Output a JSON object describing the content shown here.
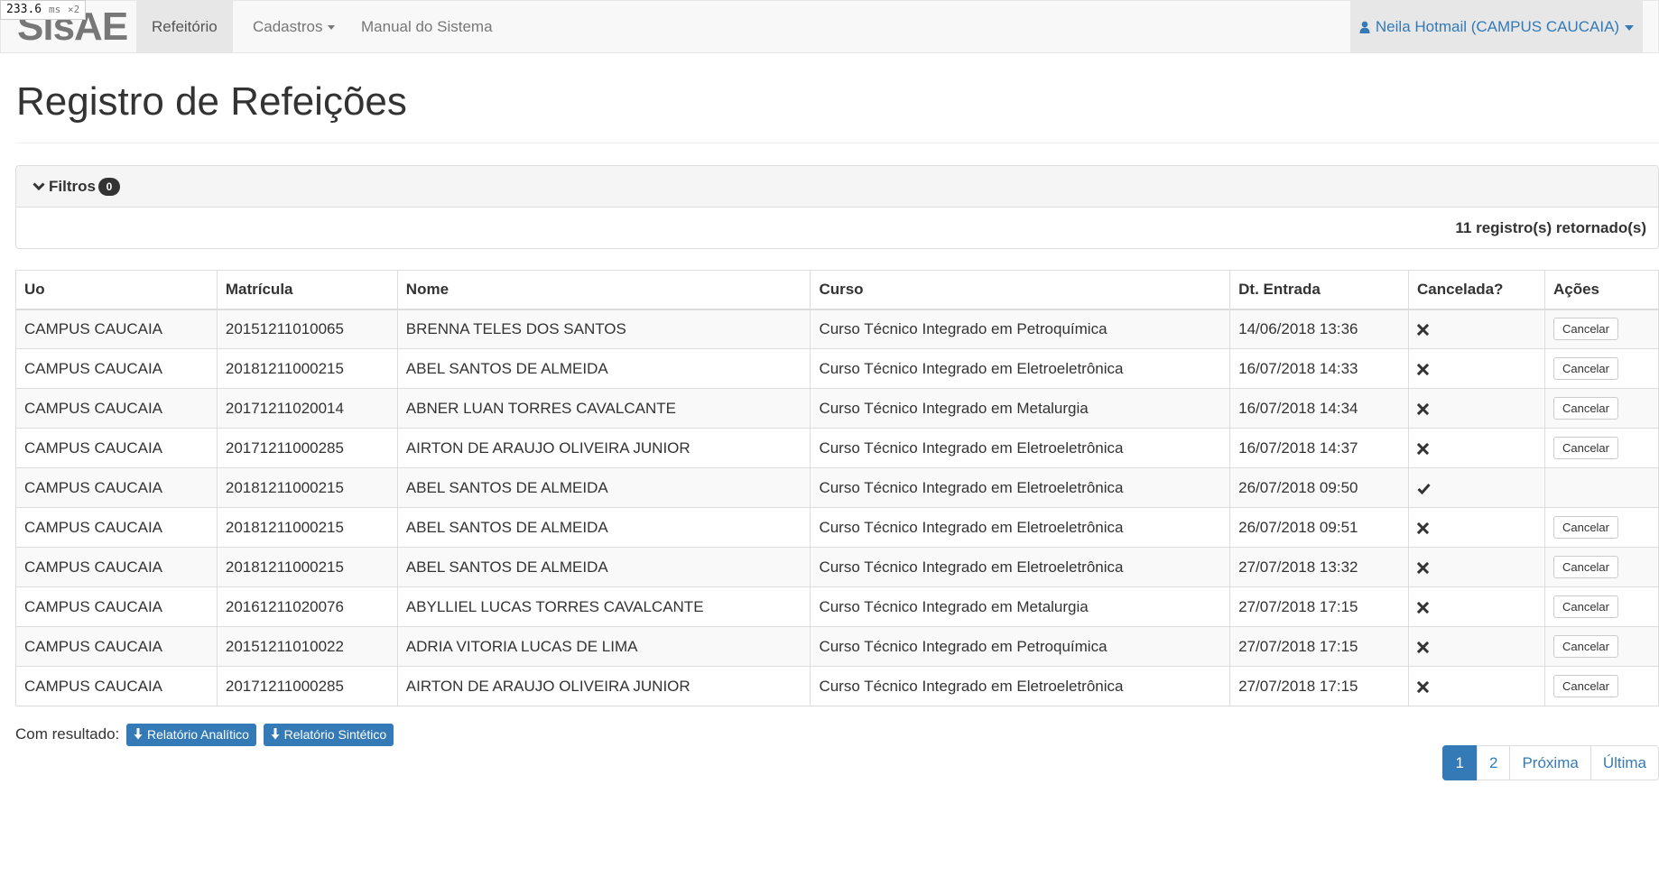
{
  "perf": {
    "value": "233.6",
    "unit": "ms",
    "multiplier": "×2"
  },
  "navbar": {
    "brand": "SisAE",
    "items": [
      {
        "label": "Refeitório"
      },
      {
        "label": "Cadastros"
      },
      {
        "label": "Manual do Sistema"
      }
    ],
    "user": "Neila Hotmail (CAMPUS CAUCAIA)"
  },
  "page": {
    "title": "Registro de Refeições"
  },
  "filters": {
    "label": "Filtros",
    "count": "0",
    "results_text": "11 registro(s) retornado(s)"
  },
  "table": {
    "headers": [
      "Uo",
      "Matrícula",
      "Nome",
      "Curso",
      "Dt. Entrada",
      "Cancelada?",
      "Ações"
    ],
    "action_label": "Cancelar",
    "rows": [
      {
        "uo": "CAMPUS CAUCAIA",
        "matricula": "20151211010065",
        "nome": "BRENNA TELES DOS SANTOS",
        "curso": "Curso Técnico Integrado em Petroquímica",
        "entrada": "14/06/2018 13:36",
        "cancelada": false
      },
      {
        "uo": "CAMPUS CAUCAIA",
        "matricula": "20181211000215",
        "nome": "ABEL SANTOS DE ALMEIDA",
        "curso": "Curso Técnico Integrado em Eletroeletrônica",
        "entrada": "16/07/2018 14:33",
        "cancelada": false
      },
      {
        "uo": "CAMPUS CAUCAIA",
        "matricula": "20171211020014",
        "nome": "ABNER LUAN TORRES CAVALCANTE",
        "curso": "Curso Técnico Integrado em Metalurgia",
        "entrada": "16/07/2018 14:34",
        "cancelada": false
      },
      {
        "uo": "CAMPUS CAUCAIA",
        "matricula": "20171211000285",
        "nome": "AIRTON DE ARAUJO OLIVEIRA JUNIOR",
        "curso": "Curso Técnico Integrado em Eletroeletrônica",
        "entrada": "16/07/2018 14:37",
        "cancelada": false
      },
      {
        "uo": "CAMPUS CAUCAIA",
        "matricula": "20181211000215",
        "nome": "ABEL SANTOS DE ALMEIDA",
        "curso": "Curso Técnico Integrado em Eletroeletrônica",
        "entrada": "26/07/2018 09:50",
        "cancelada": true
      },
      {
        "uo": "CAMPUS CAUCAIA",
        "matricula": "20181211000215",
        "nome": "ABEL SANTOS DE ALMEIDA",
        "curso": "Curso Técnico Integrado em Eletroeletrônica",
        "entrada": "26/07/2018 09:51",
        "cancelada": false
      },
      {
        "uo": "CAMPUS CAUCAIA",
        "matricula": "20181211000215",
        "nome": "ABEL SANTOS DE ALMEIDA",
        "curso": "Curso Técnico Integrado em Eletroeletrônica",
        "entrada": "27/07/2018 13:32",
        "cancelada": false
      },
      {
        "uo": "CAMPUS CAUCAIA",
        "matricula": "20161211020076",
        "nome": "ABYLLIEL LUCAS TORRES CAVALCANTE",
        "curso": "Curso Técnico Integrado em Metalurgia",
        "entrada": "27/07/2018 17:15",
        "cancelada": false
      },
      {
        "uo": "CAMPUS CAUCAIA",
        "matricula": "20151211010022",
        "nome": "ADRIA VITORIA LUCAS DE LIMA",
        "curso": "Curso Técnico Integrado em Petroquímica",
        "entrada": "27/07/2018 17:15",
        "cancelada": false
      },
      {
        "uo": "CAMPUS CAUCAIA",
        "matricula": "20171211000285",
        "nome": "AIRTON DE ARAUJO OLIVEIRA JUNIOR",
        "curso": "Curso Técnico Integrado em Eletroeletrônica",
        "entrada": "27/07/2018 17:15",
        "cancelada": false
      }
    ]
  },
  "results": {
    "label": "Com resultado:",
    "analytic_button": "Relatório Analítico",
    "synthetic_button": "Relatório Sintético"
  },
  "pagination": {
    "pages": [
      "1",
      "2"
    ],
    "current": "1",
    "next": "Próxima",
    "last": "Última"
  },
  "colors": {
    "primary": "#337ab7",
    "navbar_bg": "#f8f8f8",
    "badge_bg": "#333333"
  },
  "icons": {
    "not_cancelled": "times-icon",
    "cancelled": "check-icon",
    "user": "user-icon",
    "download": "download-icon",
    "filter_toggle": "chevron-down-icon"
  }
}
